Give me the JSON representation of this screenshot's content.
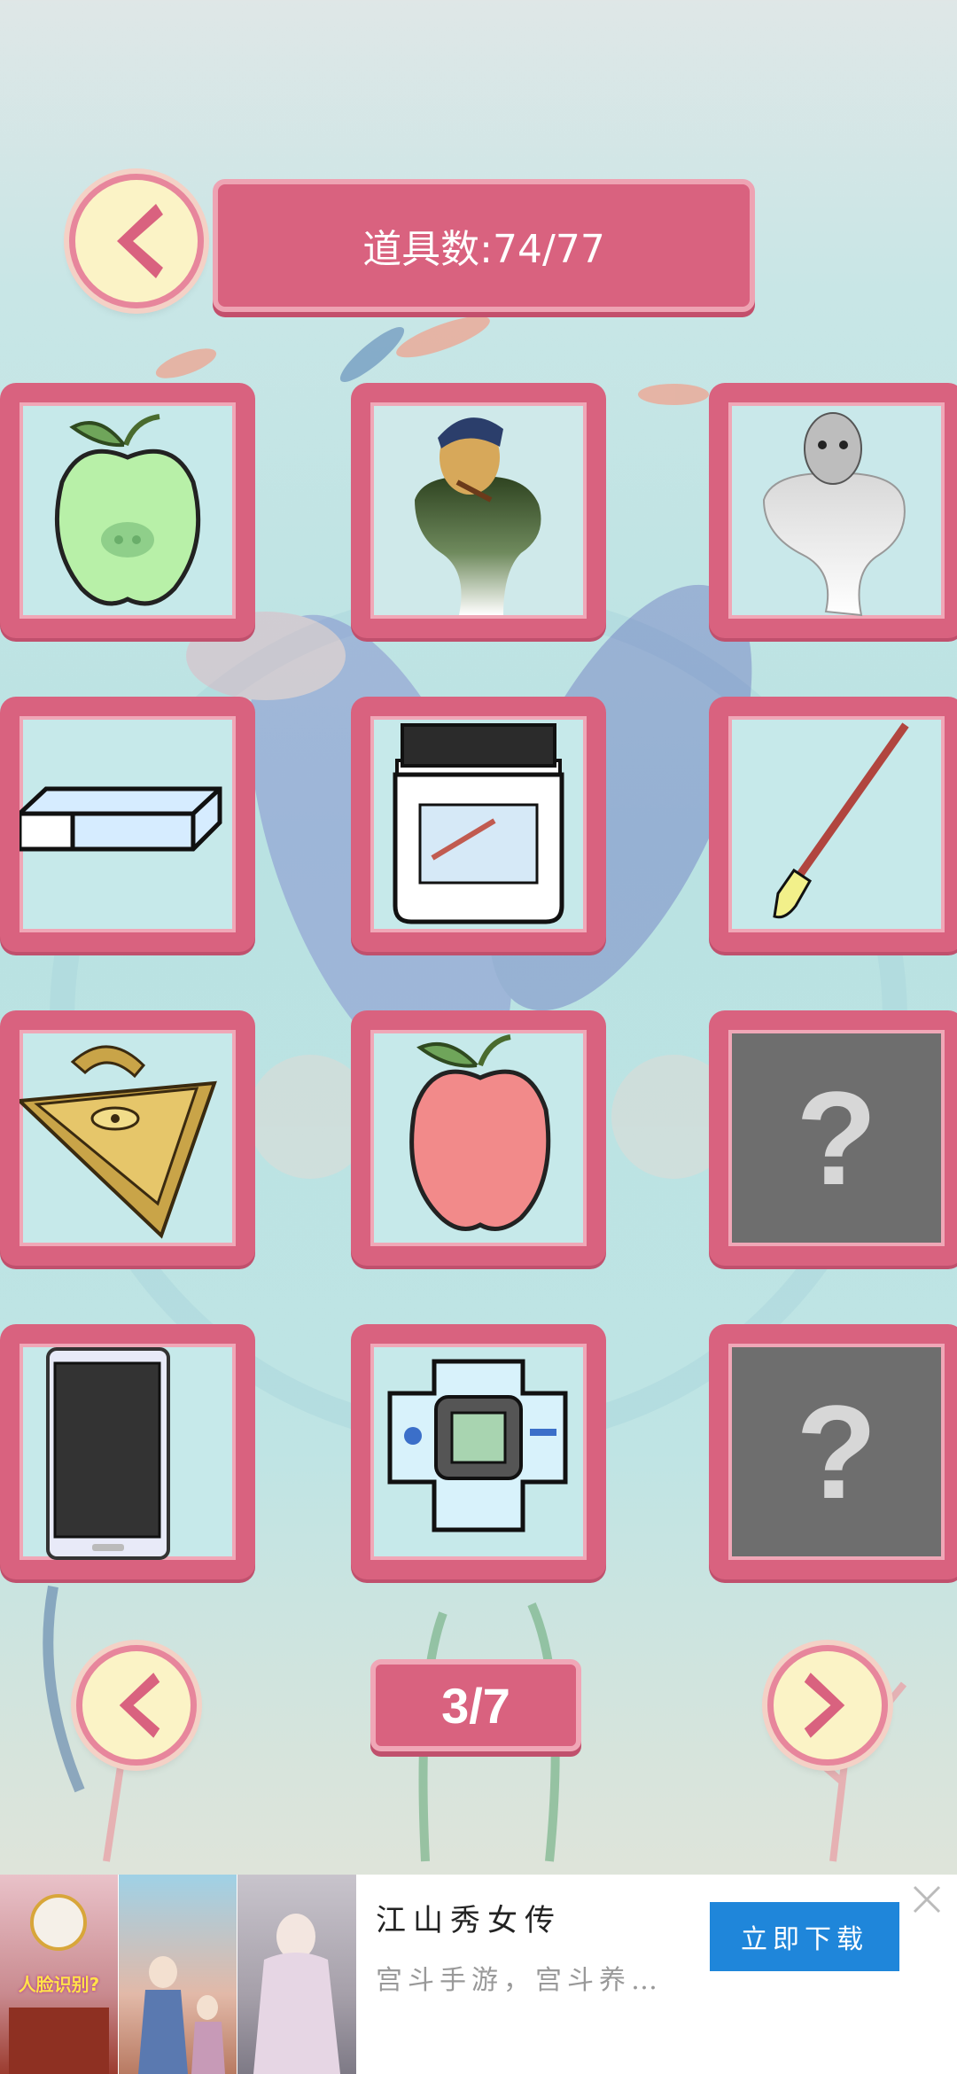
{
  "header": {
    "item_count_label": "道具数:74/77",
    "back_icon": "chevron-left-icon"
  },
  "grid": {
    "slots": [
      {
        "icon": "green-pig-apple-icon",
        "locked": false
      },
      {
        "icon": "van-gogh-ghost-icon",
        "locked": false
      },
      {
        "icon": "picasso-ghost-icon",
        "locked": false
      },
      {
        "icon": "eraser-icon",
        "locked": false
      },
      {
        "icon": "paint-jar-icon",
        "locked": false
      },
      {
        "icon": "paintbrush-icon",
        "locked": false
      },
      {
        "icon": "millennium-puzzle-icon",
        "locked": false
      },
      {
        "icon": "red-apple-icon",
        "locked": false
      },
      {
        "icon": "question-mark-icon",
        "locked": true,
        "label": "?"
      },
      {
        "icon": "smartphone-icon",
        "locked": false
      },
      {
        "icon": "digivice-icon",
        "locked": false
      },
      {
        "icon": "question-mark-icon",
        "locked": true,
        "label": "?"
      }
    ]
  },
  "pagination": {
    "page_label": "3/7",
    "prev_icon": "chevron-left-icon",
    "next_icon": "chevron-right-icon"
  },
  "ad": {
    "title": "江山秀女传",
    "subtitle": "宫斗手游，宫斗养…",
    "button_label": "立即下载",
    "thumb_caption": "人脸识别?",
    "close_icon": "close-icon"
  },
  "colors": {
    "frame_pink": "#d9627f",
    "button_cream": "#fbf3c6",
    "ad_blue": "#1f86da"
  }
}
